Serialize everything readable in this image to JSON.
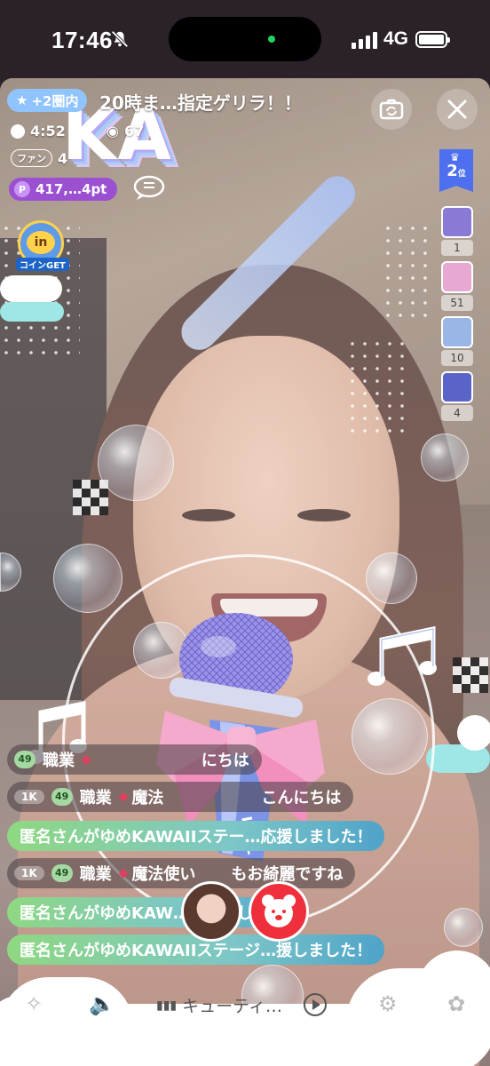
{
  "status_bar": {
    "time": "17:46",
    "network": "4G",
    "icons": [
      "bell-slash-icon",
      "cellular-signal-icon",
      "battery-icon"
    ]
  },
  "stream": {
    "rank_pill": "+2圏内",
    "title": "20時ま…指定ゲリラ！！",
    "viewer_time": "4:52",
    "viewer_count": "67",
    "fan_label": "ファン",
    "fan_value": "4",
    "points": "417,…4pt",
    "overlay_text": "KA",
    "coin_label": "コインGET"
  },
  "ranking": {
    "rank_number": "2",
    "rank_unit": "位"
  },
  "gifts": [
    {
      "count": "1",
      "color": "#8a7ad6"
    },
    {
      "count": "51",
      "color": "#e7a9d4"
    },
    {
      "count": "10",
      "color": "#9ab6e6"
    },
    {
      "count": "4",
      "color": "#5a63c8"
    }
  ],
  "chat": {
    "messages": [
      {
        "type": "dark",
        "level": "49",
        "job": "職業",
        "text": "にちは"
      },
      {
        "type": "dark",
        "k": "1K",
        "level": "49",
        "job": "職業",
        "title": "魔法",
        "text": "こんにちは"
      },
      {
        "type": "green",
        "text": "匿名さんがゆめKAWAIIステー…応援しました！"
      },
      {
        "type": "dark",
        "k": "1K",
        "level": "49",
        "job": "職業",
        "title": "魔法使い",
        "text": "もお綺麗ですね"
      },
      {
        "type": "green",
        "text": "匿名さんがゆめKAW…援しました！"
      },
      {
        "type": "green",
        "text": "匿名さんがゆめKAWAIIステージ…援しました！"
      }
    ]
  },
  "bottom_bar": {
    "music_label": "キューティ…"
  },
  "colors": {
    "accent_purple": "#9b4fd1",
    "accent_blue": "#4d6ff0",
    "bear_red": "#ef2f3b"
  }
}
